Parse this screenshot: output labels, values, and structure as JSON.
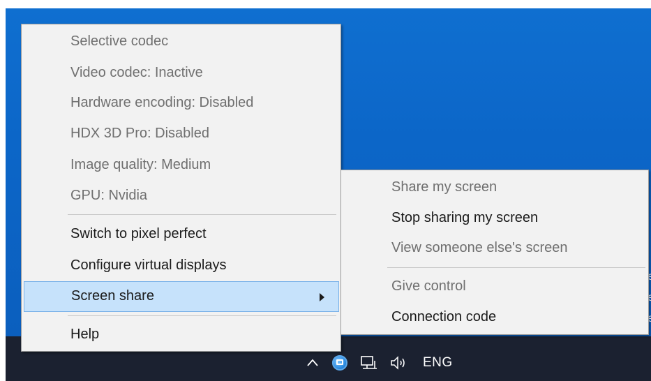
{
  "main_menu": {
    "info_items": [
      {
        "label": "Selective codec"
      },
      {
        "label": "Video codec: Inactive"
      },
      {
        "label": "Hardware encoding: Disabled"
      },
      {
        "label": "HDX 3D Pro: Disabled"
      },
      {
        "label": "Image quality: Medium"
      },
      {
        "label": "GPU: Nvidia"
      }
    ],
    "switch_pixel_perfect": "Switch to pixel perfect",
    "configure_displays": "Configure virtual displays",
    "screen_share": "Screen share",
    "help": "Help"
  },
  "submenu": {
    "share_my_screen": "Share my screen",
    "stop_sharing": "Stop sharing my screen",
    "view_someone": "View someone else's screen",
    "give_control": "Give control",
    "connection_code": "Connection code"
  },
  "taskbar": {
    "language": "ENG",
    "icons": [
      "chevron-up-icon",
      "citrix-app-icon",
      "network-icon",
      "volume-icon"
    ]
  },
  "colors": {
    "desktop": "#0c66c8",
    "taskbar": "#1b2130",
    "menu_bg": "#f2f2f2",
    "highlight": "#c6e2fb"
  }
}
